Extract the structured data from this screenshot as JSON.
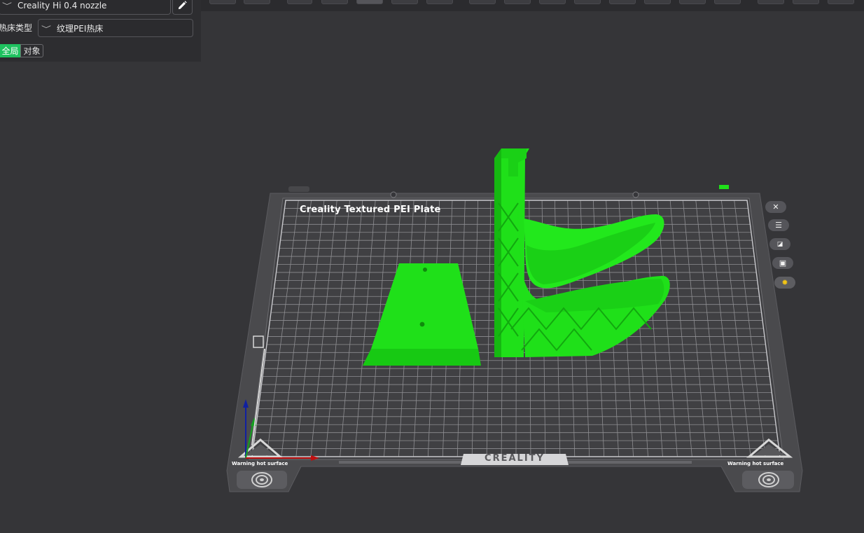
{
  "printer": {
    "name": "Creality Hi 0.4 nozzle"
  },
  "bed_type": {
    "label": "热床类型",
    "value": "纹理PEI热床"
  },
  "scope": {
    "global": "全局",
    "object": "对象"
  },
  "plate": {
    "name": "Creality Textured PEI Plate",
    "brand": "CREALITY"
  },
  "warning": {
    "text": "Warning hot surface"
  },
  "right_tools": [
    "close-icon",
    "list-icon",
    "auto-orient-icon",
    "lock-icon",
    "gear-icon"
  ],
  "colors": {
    "accent": "#1ec25f",
    "model": "#1fe019",
    "background": "#353538"
  }
}
